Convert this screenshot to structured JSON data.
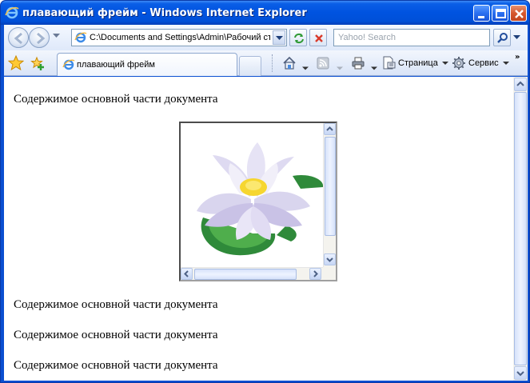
{
  "window": {
    "title": "плавающий фрейм - Windows Internet Explorer"
  },
  "navbar": {
    "address": "C:\\Documents and Settings\\Admin\\Рабочий ст",
    "search_placeholder": "Yahoo! Search"
  },
  "tabbar": {
    "tab_label": "плавающий фрейм"
  },
  "commandbar": {
    "page_label": "Страница",
    "tools_label": "Сервис",
    "more": "»"
  },
  "content": {
    "paragraphs": [
      "Содержимое основной части документа",
      "Содержимое основной части документа",
      "Содержимое основной части документа",
      "Содержимое основной части документа"
    ],
    "iframe_image": "water-lily"
  },
  "colors": {
    "title_bar": "#0053e0",
    "window_frame": "#0a4fd1",
    "toolbar": "#dfe9fa"
  }
}
